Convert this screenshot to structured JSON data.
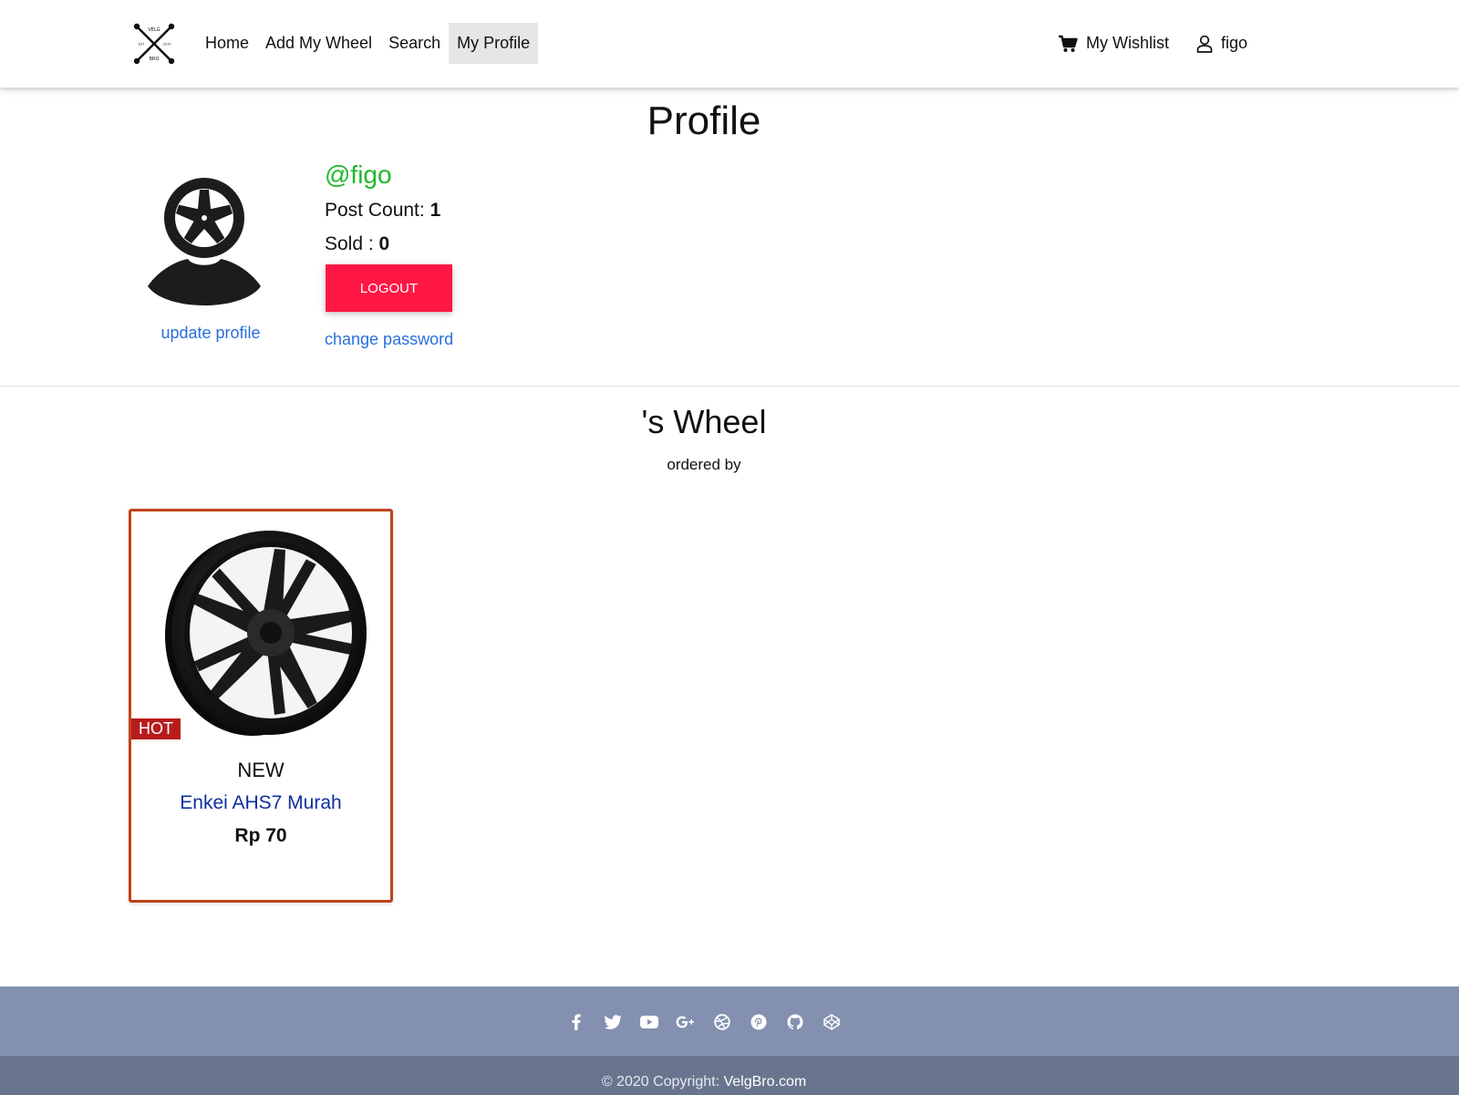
{
  "navbar": {
    "logo_text": {
      "top": "VELG",
      "left": "EST",
      "right": "2019",
      "bottom": "BRO"
    },
    "links": [
      {
        "label": "Home",
        "active": false
      },
      {
        "label": "Add My Wheel",
        "active": false
      },
      {
        "label": "Search",
        "active": false
      },
      {
        "label": "My Profile",
        "active": true
      }
    ],
    "wishlist_label": "My Wishlist",
    "user_label": "figo",
    "icons": {
      "wishlist": "cart-icon",
      "user": "user-icon"
    }
  },
  "profile": {
    "title": "Profile",
    "username": "@figo",
    "post_count_label": "Post Count: ",
    "post_count": "1",
    "sold_label": "Sold : ",
    "sold": "0",
    "logout_label": "LOGOUT",
    "update_profile_label": "update profile",
    "change_password_label": "change password",
    "colors": {
      "username": "#1fb829",
      "logout": "#ff1744",
      "link": "#2a6fdb"
    }
  },
  "wheels": {
    "title": "'s Wheel",
    "ordered_by": "ordered by",
    "items": [
      {
        "badge": "HOT",
        "condition": "NEW",
        "name": "Enkei AHS7 Murah",
        "price": "Rp 70"
      }
    ],
    "colors": {
      "card_border": "#c0431c",
      "badge": "#b71c1c",
      "name": "#0d2ea0"
    }
  },
  "footer": {
    "social_icons": [
      "facebook-icon",
      "twitter-icon",
      "youtube-icon",
      "google-plus-icon",
      "dribbble-icon",
      "pinterest-icon",
      "github-icon",
      "codepen-icon"
    ],
    "copyright_prefix": "© 2020 Copyright: ",
    "copyright_link": "VelgBro.com",
    "colors": {
      "footer": "#8390af",
      "copyright_bar": "#69758f"
    }
  }
}
